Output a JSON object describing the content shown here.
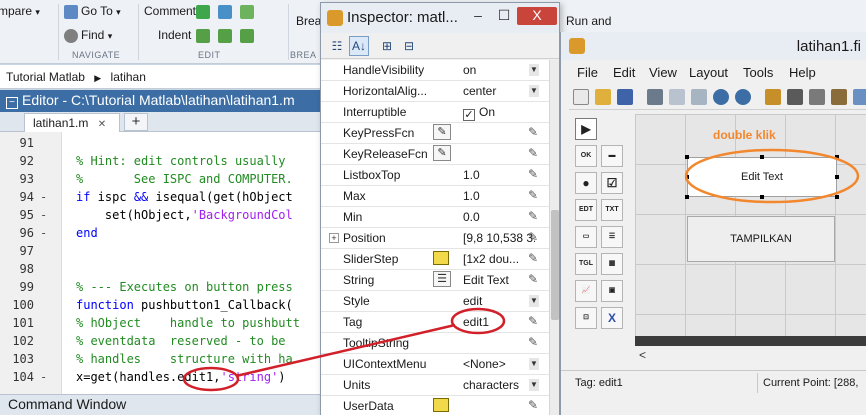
{
  "ribbon": {
    "compare_label": "mpare",
    "goto_label": "Go To",
    "find_label": "Find",
    "comment_label": "Comment",
    "indent_label": "Indent",
    "breakpoints_label": "Brea",
    "navigate_section": "NAVIGATE",
    "edit_section": "EDIT",
    "brea_section": "BREA",
    "run_and_label": "Run and"
  },
  "breadcrumb": {
    "items": [
      "Tutorial Matlab",
      "latihan"
    ]
  },
  "editor": {
    "title": "Editor - C:\\Tutorial Matlab\\latihan\\latihan1.m",
    "tab_label": "latihan1.m",
    "add_tab": "+",
    "lines": [
      {
        "num": "91",
        "dash": "",
        "text": "",
        "kind": "nrm"
      },
      {
        "num": "92",
        "dash": "",
        "text": "% Hint: edit controls usually",
        "kind": "com"
      },
      {
        "num": "93",
        "dash": "",
        "text": "%       See ISPC and COMPUTER.",
        "kind": "com"
      },
      {
        "num": "94",
        "dash": "-",
        "text": "if ispc && isequal(get(hObject",
        "kind": "kwmix"
      },
      {
        "num": "95",
        "dash": "-",
        "text": "    set(hObject,'BackgroundCol",
        "kind": "strmix"
      },
      {
        "num": "96",
        "dash": "-",
        "text": "end",
        "kind": "kw"
      },
      {
        "num": "97",
        "dash": "",
        "text": "",
        "kind": "nrm"
      },
      {
        "num": "98",
        "dash": "",
        "text": "",
        "kind": "nrm"
      },
      {
        "num": "99",
        "dash": "",
        "text": "% --- Executes on button press",
        "kind": "com"
      },
      {
        "num": "100",
        "dash": "",
        "text": "function pushbutton1_Callback(",
        "kind": "fn"
      },
      {
        "num": "101",
        "dash": "",
        "text": "% hObject    handle to pushbutt",
        "kind": "com"
      },
      {
        "num": "102",
        "dash": "",
        "text": "% eventdata  reserved - to be",
        "kind": "com"
      },
      {
        "num": "103",
        "dash": "",
        "text": "% handles    structure with ha",
        "kind": "com"
      },
      {
        "num": "104",
        "dash": "-",
        "text": "x=get(handles.edit1,'string')",
        "kind": "last"
      }
    ]
  },
  "command_window": "Command Window",
  "inspector": {
    "title": "Inspector:  matl...",
    "window_min": "–",
    "window_max": "☐",
    "window_close": "X",
    "properties": [
      {
        "name": "HandleVisibility",
        "value": "on",
        "control": "dropdown"
      },
      {
        "name": "HorizontalAlig...",
        "value": "center",
        "control": "dropdown"
      },
      {
        "name": "Interruptible",
        "value": "On",
        "control": "checkbox"
      },
      {
        "name": "KeyPressFcn",
        "value": "",
        "control": "callback"
      },
      {
        "name": "KeyReleaseFcn",
        "value": "",
        "control": "callback"
      },
      {
        "name": "ListboxTop",
        "value": "1.0",
        "control": "edit"
      },
      {
        "name": "Max",
        "value": "1.0",
        "control": "edit"
      },
      {
        "name": "Min",
        "value": "0.0",
        "control": "edit"
      },
      {
        "name": "Position",
        "value": "[9,8 10,538 3...",
        "control": "expand"
      },
      {
        "name": "SliderStep",
        "value": "[1x2  dou...",
        "control": "swatch"
      },
      {
        "name": "String",
        "value": "Edit Text",
        "control": "text"
      },
      {
        "name": "Style",
        "value": "edit",
        "control": "dropdown"
      },
      {
        "name": "Tag",
        "value": "edit1",
        "control": "edit"
      },
      {
        "name": "TooltipString",
        "value": "",
        "control": "edit"
      },
      {
        "name": "UIContextMenu",
        "value": "<None>",
        "control": "dropdown"
      },
      {
        "name": "Units",
        "value": "characters",
        "control": "dropdown"
      },
      {
        "name": "UserData",
        "value": "",
        "control": "swatch"
      }
    ]
  },
  "guide": {
    "title": "latihan1.fi",
    "menu": [
      "File",
      "Edit",
      "View",
      "Layout",
      "Tools",
      "Help"
    ],
    "palette": [
      "▶",
      "OK",
      "▬",
      "●",
      "☑",
      "EDT",
      "TXT",
      "▭",
      "☰",
      "TGL",
      "▦",
      "📈",
      "▣",
      "⊡",
      "X"
    ],
    "edit_text_label": "Edit Text",
    "push_button_label": "TAMPILKAN",
    "annotation": "double klik",
    "status_tag": "Tag: edit1",
    "status_point": "Current Point:  [288,",
    "scroll_left": "<"
  },
  "colors": {
    "annotation_orange": "#f2872d",
    "annotation_red": "#d2202a",
    "editor_title_blue": "#3c6ea5"
  }
}
